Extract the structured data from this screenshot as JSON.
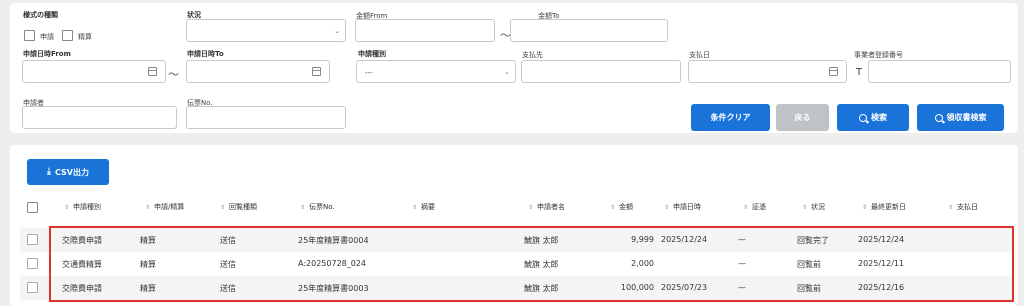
{
  "filters": {
    "form_type_label": "様式の種類",
    "opt_apply": "申請",
    "opt_settle": "精算",
    "status_label": "状況",
    "amount_from_label": "金額From",
    "amount_to_label": "金額To",
    "tilde": "～",
    "apply_date_from_label": "申請日時From",
    "apply_date_to_label": "申請日時To",
    "apply_kind_label": "申請種別",
    "apply_kind_value": "---",
    "payee_label": "支払先",
    "pay_date_label": "支払日",
    "reg_no_label": "事業者登録番号",
    "reg_prefix": "T",
    "applicant_label": "申請者",
    "voucher_label": "伝票No."
  },
  "buttons": {
    "clear": "条件クリア",
    "back": "戻る",
    "search": "検索",
    "receipt_search": "領収書検索",
    "csv": "CSV出力"
  },
  "table": {
    "headers": [
      "申請種別",
      "申請/精算",
      "回覧種類",
      "伝票No.",
      "摘要",
      "申請者名",
      "金額",
      "申請日時",
      "証憑",
      "状況",
      "最終更新日",
      "支払日"
    ],
    "rows": [
      {
        "kind": "交際費申請",
        "type": "精算",
        "circ": "送信",
        "voucher": "25年度精算書0004",
        "memo": "",
        "name": "鯱旗 太郎",
        "amount": "9,999",
        "date": "2025/12/24",
        "evidence": "—",
        "status": "回覧完了",
        "updated": "2025/12/24",
        "paydate": ""
      },
      {
        "kind": "交通費精算",
        "type": "精算",
        "circ": "送信",
        "voucher": "A:20250728_024",
        "memo": "",
        "name": "鯱旗 太郎",
        "amount": "2,000",
        "date": "",
        "evidence": "—",
        "status": "回覧前",
        "updated": "2025/12/11",
        "paydate": ""
      },
      {
        "kind": "交際費申請",
        "type": "精算",
        "circ": "送信",
        "voucher": "25年度精算書0003",
        "memo": "",
        "name": "鯱旗 太郎",
        "amount": "100,000",
        "date": "2025/07/23",
        "evidence": "—",
        "status": "回覧前",
        "updated": "2025/12/16",
        "paydate": ""
      }
    ]
  },
  "colors": {
    "primary": "#1a73d9",
    "highlight": "#e03131",
    "disabled": "#bfc3c8"
  }
}
